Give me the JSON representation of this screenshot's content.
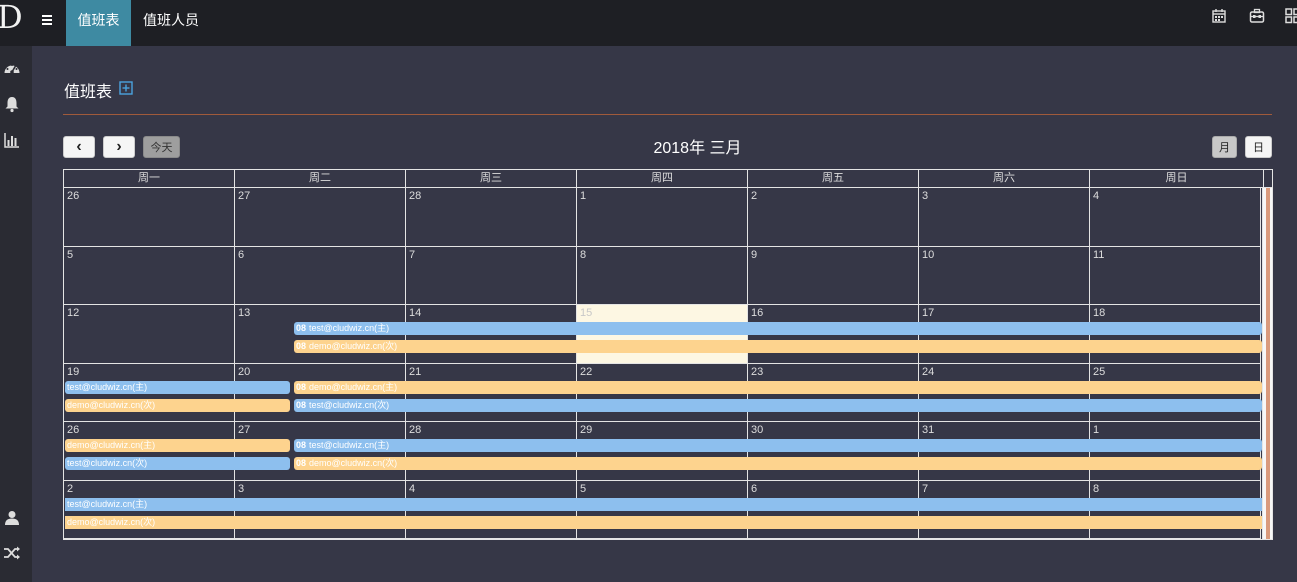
{
  "app": {
    "logo": "D"
  },
  "nav": {
    "tabs": [
      {
        "label": "值班表"
      },
      {
        "label": "值班人员"
      }
    ],
    "top_icons": [
      "calendar-icon",
      "toolbox-icon",
      "apps-grid-icon"
    ]
  },
  "sidebar": {
    "icons": [
      "dashboard-icon",
      "bell-icon",
      "bar-chart-icon",
      "user-icon",
      "shuffle-icon"
    ]
  },
  "page": {
    "title": "值班表",
    "add_icon": "plus-square-icon"
  },
  "calendar": {
    "prev_label": "‹",
    "next_label": "›",
    "today_label": "今天",
    "title": "2018年 三月",
    "view_month": "月",
    "view_day": "日",
    "weekdays": [
      "周一",
      "周二",
      "周三",
      "周四",
      "周五",
      "周六",
      "周日"
    ],
    "weeks": [
      [
        "26",
        "27",
        "28",
        "1",
        "2",
        "3",
        "4"
      ],
      [
        "5",
        "6",
        "7",
        "8",
        "9",
        "10",
        "11"
      ],
      [
        "12",
        "13",
        "14",
        "15",
        "16",
        "17",
        "18"
      ],
      [
        "19",
        "20",
        "21",
        "22",
        "23",
        "24",
        "25"
      ],
      [
        "26",
        "27",
        "28",
        "29",
        "30",
        "31",
        "1"
      ],
      [
        "2",
        "3",
        "4",
        "5",
        "6",
        "7",
        "8"
      ]
    ],
    "today_cell": {
      "week": 2,
      "day": 3
    },
    "events": [
      {
        "week": 2,
        "start": 1,
        "end": 7,
        "lane": 0,
        "time": "08",
        "text": "test@cludwiz.cn(主)",
        "color": "blue"
      },
      {
        "week": 2,
        "start": 1,
        "end": 7,
        "lane": 1,
        "time": "08",
        "text": "demo@cludwiz.cn(次)",
        "color": "orange"
      },
      {
        "week": 3,
        "start": 0,
        "end": 1,
        "lane": 0,
        "time": "",
        "text": "test@cludwiz.cn(主)",
        "color": "blue"
      },
      {
        "week": 3,
        "start": 0,
        "end": 1,
        "lane": 1,
        "time": "",
        "text": "demo@cludwiz.cn(次)",
        "color": "orange"
      },
      {
        "week": 3,
        "start": 1,
        "end": 7,
        "lane": 0,
        "time": "08",
        "text": "demo@cludwiz.cn(主)",
        "color": "orange"
      },
      {
        "week": 3,
        "start": 1,
        "end": 7,
        "lane": 1,
        "time": "08",
        "text": "test@cludwiz.cn(次)",
        "color": "blue"
      },
      {
        "week": 4,
        "start": 0,
        "end": 1,
        "lane": 0,
        "time": "",
        "text": "demo@cludwiz.cn(主)",
        "color": "orange"
      },
      {
        "week": 4,
        "start": 0,
        "end": 1,
        "lane": 1,
        "time": "",
        "text": "test@cludwiz.cn(次)",
        "color": "blue"
      },
      {
        "week": 4,
        "start": 1,
        "end": 7,
        "lane": 0,
        "time": "08",
        "text": "test@cludwiz.cn(主)",
        "color": "blue"
      },
      {
        "week": 4,
        "start": 1,
        "end": 7,
        "lane": 1,
        "time": "08",
        "text": "demo@cludwiz.cn(次)",
        "color": "orange"
      },
      {
        "week": 5,
        "start": 0,
        "end": 7,
        "lane": 0,
        "time": "",
        "text": "test@cludwiz.cn(主)",
        "color": "blue"
      },
      {
        "week": 5,
        "start": 0,
        "end": 7,
        "lane": 1,
        "time": "",
        "text": "demo@cludwiz.cn(次)",
        "color": "orange"
      }
    ]
  },
  "colors": {
    "accent": "#3e8aa2",
    "blue_event": "#8dbfee",
    "orange_event": "#fdd38e",
    "today": "#fdf7e3",
    "divider": "#a05a3b"
  }
}
